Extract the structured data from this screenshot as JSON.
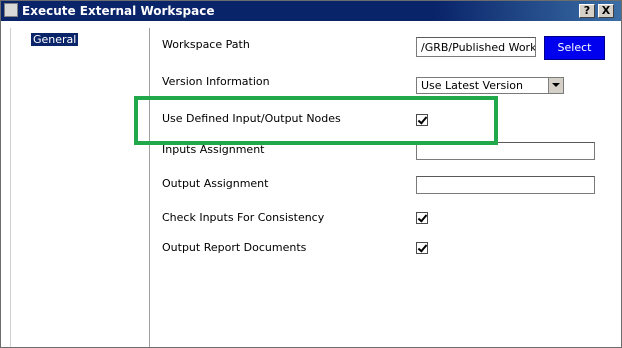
{
  "window": {
    "title": "Execute External Workspace",
    "help_label": "?",
    "close_label": "X"
  },
  "sidebar": {
    "items": [
      {
        "label": "General"
      }
    ]
  },
  "form": {
    "workspace_path": {
      "label": "Workspace Path",
      "value": "/GRB/Published Workspace",
      "button_label": "Select"
    },
    "version_information": {
      "label": "Version Information",
      "selected": "Use Latest Version"
    },
    "use_defined_io_nodes": {
      "label": "Use Defined Input/Output Nodes",
      "checked": true
    },
    "inputs_assignment": {
      "label": "Inputs Assignment",
      "value": ""
    },
    "output_assignment": {
      "label": "Output Assignment",
      "value": ""
    },
    "check_inputs_consistency": {
      "label": "Check Inputs For Consistency",
      "checked": true
    },
    "output_report_documents": {
      "label": "Output Report Documents",
      "checked": true
    }
  },
  "colors": {
    "titlebar": "#0a246a",
    "select_button": "#0000ee",
    "highlight_border": "#21a84a"
  }
}
